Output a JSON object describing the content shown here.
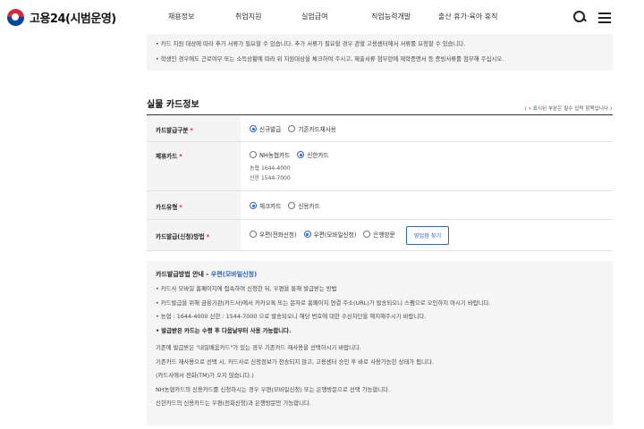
{
  "header": {
    "logo_text": "고용24(시범운영)",
    "nav": [
      "채용정보",
      "취업지원",
      "실업급여",
      "직업능력개발",
      "출산 휴가·육아 휴직"
    ]
  },
  "notice_top": [
    "• 카드 지원 대상에 따라 추가 서류가 필요할 수 있습니다. 추가 서류가 필요할 경우 관할 고용센터에서 서류를 요청할 수 있습니다.",
    "• 학생인 경우에도 근로여부 또는 소득상황에 따라 위 지원대상을 체크하여 주시고, 제출서류 첨부란에 재학증명서 등 증빙서류를 첨부해 주십시오."
  ],
  "section": {
    "title": "실물 카드정보",
    "required_note_prefix": "( ",
    "required_note_star": "•",
    "required_note_suffix": " 표시된 부분은 필수 입력 항목입니다.)"
  },
  "form": {
    "issue_type": {
      "label": "카드발급구분",
      "options": [
        "신규발급",
        "기존카드재사용"
      ],
      "selected": "신규발급"
    },
    "partner_card": {
      "label": "제휴카드",
      "options": [
        "NH농협카드",
        "신한카드"
      ],
      "selected": "신한카드",
      "phones": [
        "농협 1644-4000",
        "신한 1544-7000"
      ]
    },
    "card_type": {
      "label": "카드유형",
      "options": [
        "체크카드",
        "신용카드"
      ],
      "selected": "체크카드"
    },
    "issue_method": {
      "label": "카드발급(신청)방법",
      "options": [
        "우편(전화신청)",
        "우편(모바일신청)",
        "은행방문"
      ],
      "selected": "우편(모바일신청)",
      "find_button": "영업점 찾기"
    },
    "star": "*"
  },
  "guide": {
    "title_prefix": "카드발급방법 안내 - ",
    "title_highlight": "우편(모바일신청)",
    "lines": [
      "• 카드사 모바일 홈페이지에 접속하여 신청한 뒤, 우편을 통해 발급받는 방법",
      "• 카드발급을 위해 금융기관(카드사)에서 카카오톡 또는 문자로 홈페이지 연결 주소(URL)가 발송되오니 스팸으로 오인하지 마시기 바랍니다.",
      "• 농협 : 1644-4000 신한 : 1544-7000 으로 발송되오니 해당 번호에 대한 수신차단을 해지해주시기 바랍니다."
    ],
    "bold_line": "• 발급받은 카드는 수령 후 다음날부터 사용 가능합니다.",
    "notes": [
      "기존에 발급받은 \"내일배움카드\"가 있는 경우 기존카드 재사용을 선택하시기 바랍니다.",
      "기존카드 재사용으로 선택 시, 카드사로 신청정보가 전송되지 않고, 고용센터 승인 후 바로 사용가능한 상태가 됩니다.",
      "(카드사에서 전화(TM)가 오지 않습니다.)",
      "NH농협카드의 신용카드를 신청하시는 경우 우편(모바일신청) 또는 은행방문으로 선택 가능합니다.",
      "신한카드의 신용카드는 우편(전화신청)과 은행방문만 가능합니다."
    ]
  },
  "colors": {
    "accent": "#2b63c8",
    "required": "#d01f2f",
    "box_bg": "#f5f5f5"
  }
}
